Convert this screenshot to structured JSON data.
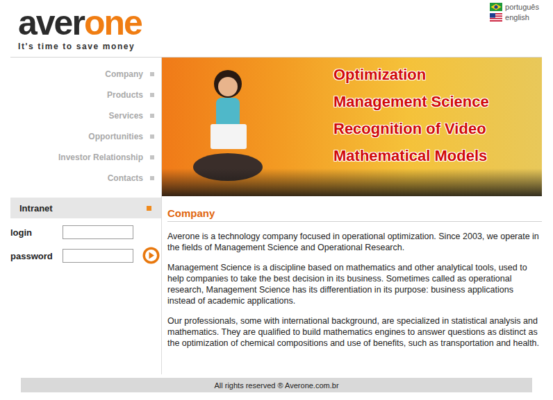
{
  "header": {
    "logo": {
      "part1": "aver",
      "part2": "one"
    },
    "tagline": "It's time to save money",
    "languages": [
      {
        "label": "português",
        "flag": "br"
      },
      {
        "label": "english",
        "flag": "us"
      }
    ]
  },
  "nav": {
    "items": [
      "Company",
      "Products",
      "Services",
      "Opportunities",
      "Investor Relationship",
      "Contacts"
    ]
  },
  "banner": {
    "headlines": [
      "Optimization",
      "Management Science",
      "Recognition of Video",
      "Mathematical Models"
    ]
  },
  "intranet": {
    "title": "Intranet",
    "fields": [
      {
        "label": "login",
        "value": ""
      },
      {
        "label": "password",
        "value": ""
      }
    ]
  },
  "content": {
    "title": "Company",
    "paragraphs": [
      "Averone is a technology company focused in operational optimization. Since 2003, we operate in the fields of Management Science and Operational Research.",
      "Management Science is a discipline based on mathematics and other analytical tools, used to help companies to take the best decision in its business. Sometimes called as operational research, Management Science has its differentiation in its purpose: business applications instead of academic applications.",
      "Our professionals, some with international background, are specialized in statistical analysis and mathematics. They are qualified to build mathematics engines to answer questions as distinct as the optimization of chemical compositions and use of benefits, such as transportation and health."
    ]
  },
  "footer": "All rights reserved ® Averone.com.br"
}
